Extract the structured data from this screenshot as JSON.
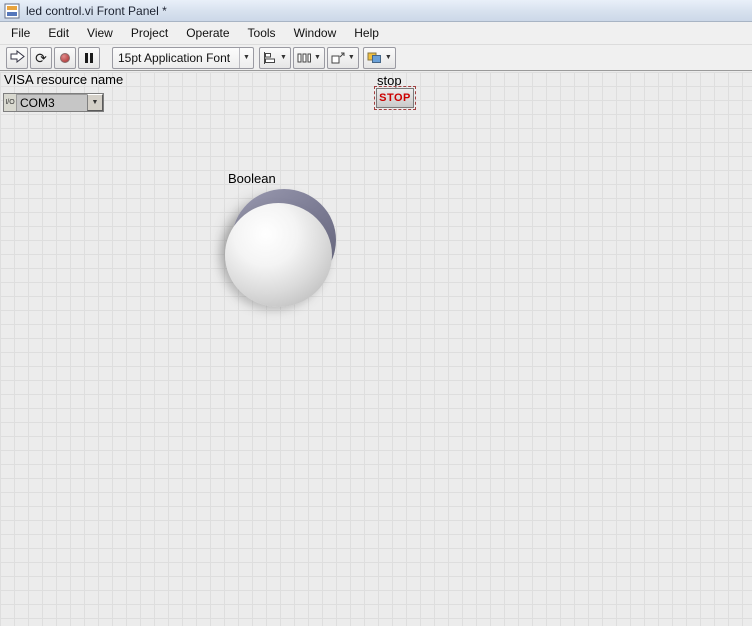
{
  "window": {
    "title": "led control.vi Front Panel *"
  },
  "menu": {
    "items": [
      "File",
      "Edit",
      "View",
      "Project",
      "Operate",
      "Tools",
      "Window",
      "Help"
    ]
  },
  "toolbar": {
    "font_selector": "15pt Application Font",
    "icons": {
      "run_continuous_glyph": "⟳",
      "combo_arrow": "▼"
    }
  },
  "panel": {
    "visa": {
      "label": "VISA resource name",
      "value": "COM3",
      "io_glyph": "I/O"
    },
    "stop": {
      "label": "stop",
      "button_label": "STOP"
    },
    "boolean": {
      "label": "Boolean"
    }
  },
  "colors": {
    "stop_text": "#cc0000",
    "abort_red": "#b84848",
    "knob_ring": "#7c7c94",
    "panel_bg": "#ececec"
  }
}
